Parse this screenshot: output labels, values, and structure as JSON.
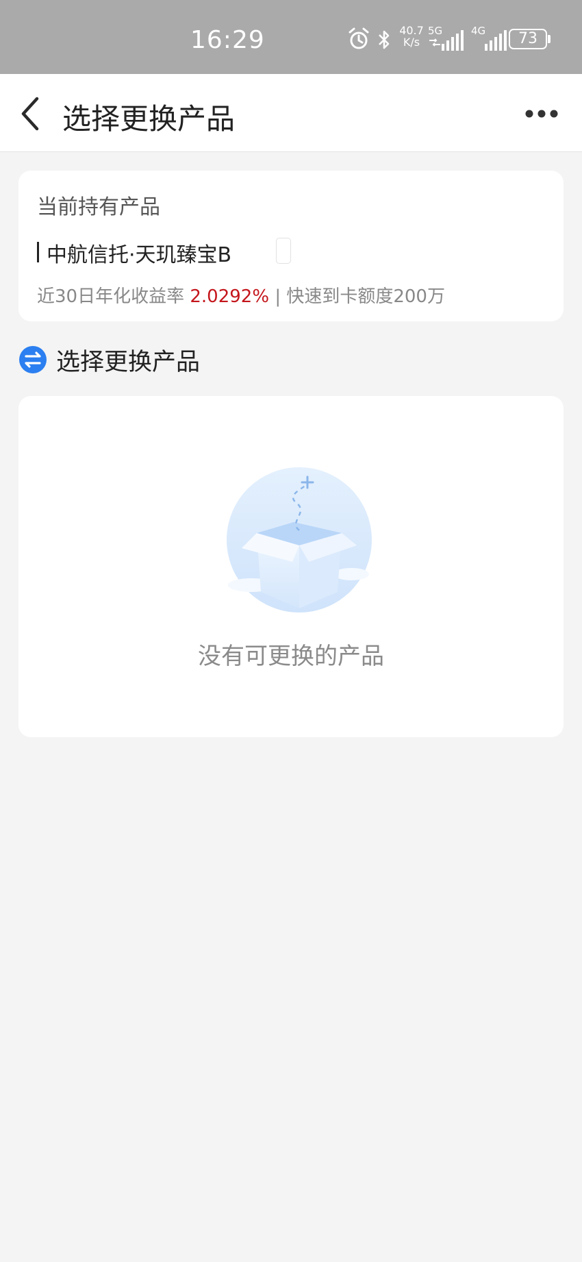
{
  "status_bar": {
    "time": "16:29",
    "network_speed_value": "40.7",
    "network_speed_unit": "K/s",
    "signal1_label": "5G",
    "signal2_label": "4G",
    "battery": "73",
    "icons": [
      "alarm-icon",
      "bluetooth-icon",
      "signal-5g-icon",
      "signal-4g-icon",
      "battery-icon"
    ]
  },
  "nav": {
    "title": "选择更换产品",
    "back_icon": "chevron-left-icon",
    "more_icon": "more-dots-icon"
  },
  "current_product": {
    "section_label": "当前持有产品",
    "name": "中航信托·天玑臻宝B",
    "yield_label": "近30日年化收益率",
    "yield_value": "2.0292%",
    "quota_text": "| 快速到卡额度200万"
  },
  "replace_section": {
    "icon": "swap-icon",
    "title": "选择更换产品",
    "empty_text": "没有可更换的产品",
    "empty_illustration": "empty-box-illustration"
  },
  "colors": {
    "accent_blue": "#2b7ff0",
    "yield_red": "#c4161c",
    "status_bar_bg": "#aaaaaa",
    "page_bg": "#f4f4f4"
  }
}
